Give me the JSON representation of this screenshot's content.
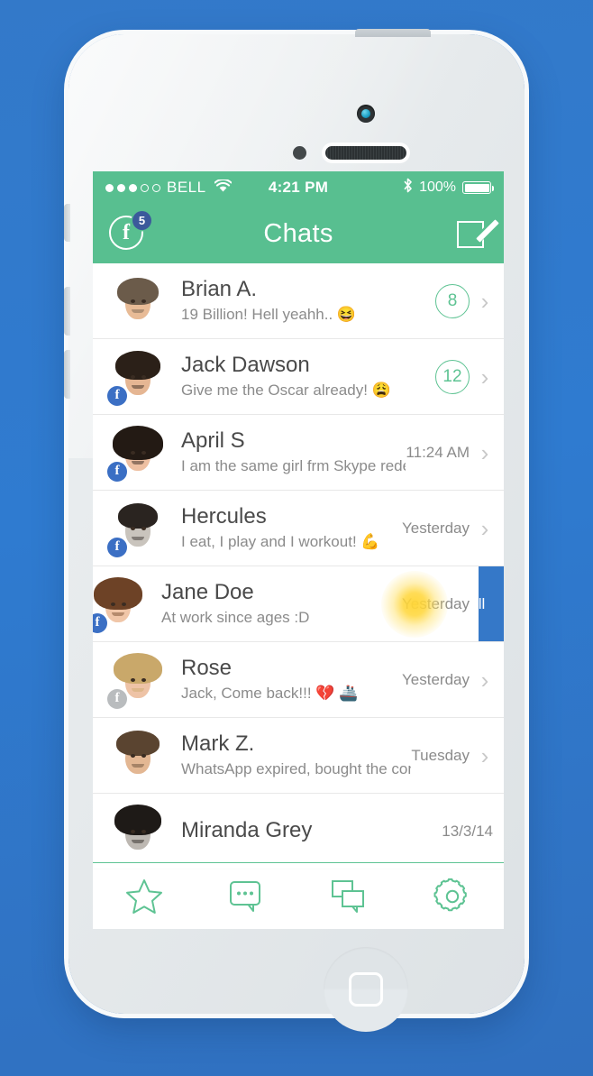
{
  "theme": {
    "accent_green": "#58bf90",
    "badge_blue": "#3b5a9b",
    "swipe_blue": "#3578c8",
    "background_blue": "#3379c9"
  },
  "status_bar": {
    "carrier": "BELL",
    "signal_dots_filled": 3,
    "signal_dots_total": 5,
    "wifi_icon": "wifi-icon",
    "time": "4:21 PM",
    "bluetooth_icon": "bluetooth-icon",
    "battery_percent": "100%",
    "battery_icon": "battery-full-icon"
  },
  "nav_bar": {
    "facebook_icon": "facebook-icon",
    "facebook_letter": "f",
    "facebook_badge_count": "5",
    "title": "Chats",
    "compose_icon": "compose-icon"
  },
  "chats": [
    {
      "name": "Brian A.",
      "message": "19 Billion! Hell yeahh.. 😆",
      "unread": "8",
      "time": "",
      "fb_badge": "none",
      "chevron": "chevron-right-icon"
    },
    {
      "name": "Jack Dawson",
      "message": "Give me the Oscar already! 😩",
      "unread": "12",
      "time": "",
      "fb_badge": "blue",
      "chevron": "chevron-right-icon"
    },
    {
      "name": "April S",
      "message": "I am the same girl frm Skype redesign!",
      "unread": "",
      "time": "11:24 AM",
      "fb_badge": "blue",
      "chevron": "chevron-right-icon"
    },
    {
      "name": "Hercules",
      "message": "I eat, I play and I workout! 💪",
      "unread": "",
      "time": "Yesterday",
      "fb_badge": "blue",
      "chevron": "chevron-right-icon"
    },
    {
      "name": "Jane Doe",
      "message": "At work since ages :D",
      "unread": "",
      "time": "Yesterday",
      "fb_badge": "blue",
      "chevron": "chevron-right-icon",
      "swiped": true,
      "swipe_action_label": "Call"
    },
    {
      "name": "Rose",
      "message": "Jack, Come back!!! 💔 🚢",
      "unread": "",
      "time": "Yesterday",
      "fb_badge": "grey",
      "chevron": "chevron-right-icon"
    },
    {
      "name": "Mark Z.",
      "message": "WhatsApp expired, bought the company",
      "unread": "",
      "time": "Tuesday",
      "fb_badge": "none",
      "chevron": "chevron-right-icon"
    },
    {
      "name": "Miranda Grey",
      "message": "",
      "unread": "",
      "time": "13/3/14",
      "fb_badge": "none",
      "chevron": ""
    }
  ],
  "tab_bar": {
    "tabs": [
      {
        "name": "favorites",
        "icon": "star-icon"
      },
      {
        "name": "messages",
        "icon": "chat-bubble-dots-icon"
      },
      {
        "name": "groups",
        "icon": "double-chat-bubble-icon"
      },
      {
        "name": "settings",
        "icon": "gear-icon"
      }
    ]
  },
  "device": {
    "camera_icon": "front-camera",
    "sensor_icon": "proximity-sensor",
    "speaker_icon": "earpiece-speaker",
    "home_button_icon": "home-button"
  }
}
